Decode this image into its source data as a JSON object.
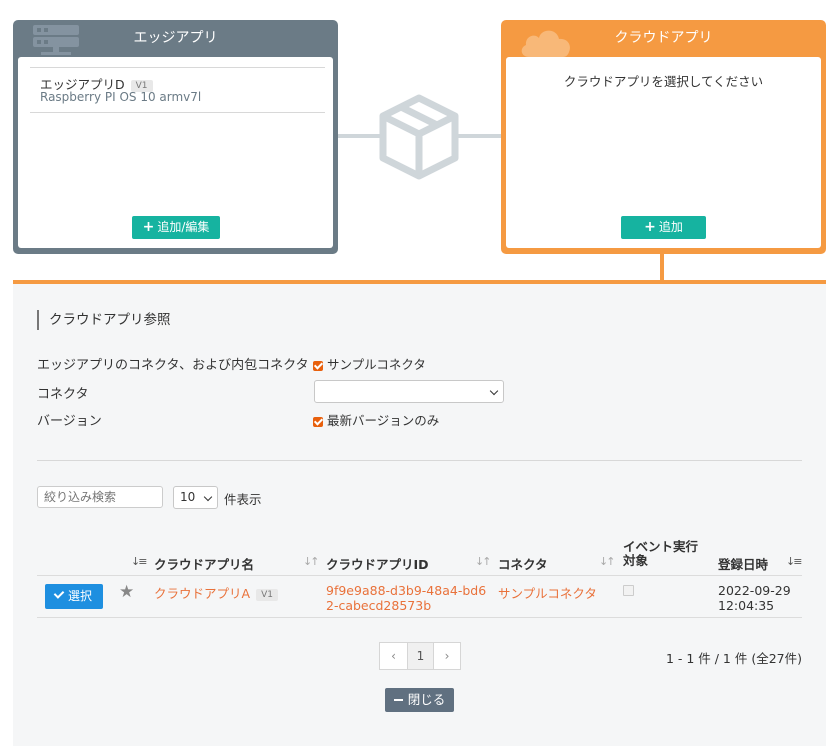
{
  "edge_card": {
    "title": "エッジアプリ",
    "item_name": "エッジアプリD",
    "item_version": "V1",
    "item_os": "Raspberry PI OS 10 armv7l",
    "button": "追加/編集",
    "color": "#6b7b86"
  },
  "cloud_card": {
    "title": "クラウドアプリ",
    "message": "クラウドアプリを選択してください",
    "button": "追加",
    "color": "#f59a42"
  },
  "panel": {
    "title": "クラウドアプリ参照",
    "form": {
      "connector_scope_label": "エッジアプリのコネクタ、および内包コネクタ",
      "connector_scope_value": "サンプルコネクタ",
      "connector_label": "コネクタ",
      "connector_value": "",
      "version_label": "バージョン",
      "version_value": "最新バージョンのみ"
    },
    "search_placeholder": "絞り込み検索",
    "page_size": "10",
    "page_size_suffix": "件表示",
    "table": {
      "headers": {
        "name": "クラウドアプリ名",
        "id": "クラウドアプリID",
        "connector": "コネクタ",
        "event_line1": "イベント実行",
        "event_line2": "対象",
        "date": "登録日時"
      },
      "rows": [
        {
          "select": "選択",
          "name": "クラウドアプリA",
          "version": "V1",
          "id_line1": "9f9e9a88-d3b9-48a4-bd6",
          "id_line2": "2-cabecd28573b",
          "connector": "サンプルコネクタ",
          "event_target": false,
          "date_line1": "2022-09-29",
          "date_line2": "12:04:35"
        }
      ]
    },
    "pagination": {
      "prev": "‹",
      "current": "1",
      "next": "›"
    },
    "count": "1 - 1 件 / 1 件 (全27件)",
    "close": "閉じる"
  },
  "colors": {
    "accent_orange": "#f59a42",
    "link_orange": "#e9713a",
    "teal": "#16b3a0",
    "blue": "#1e8fe0"
  }
}
